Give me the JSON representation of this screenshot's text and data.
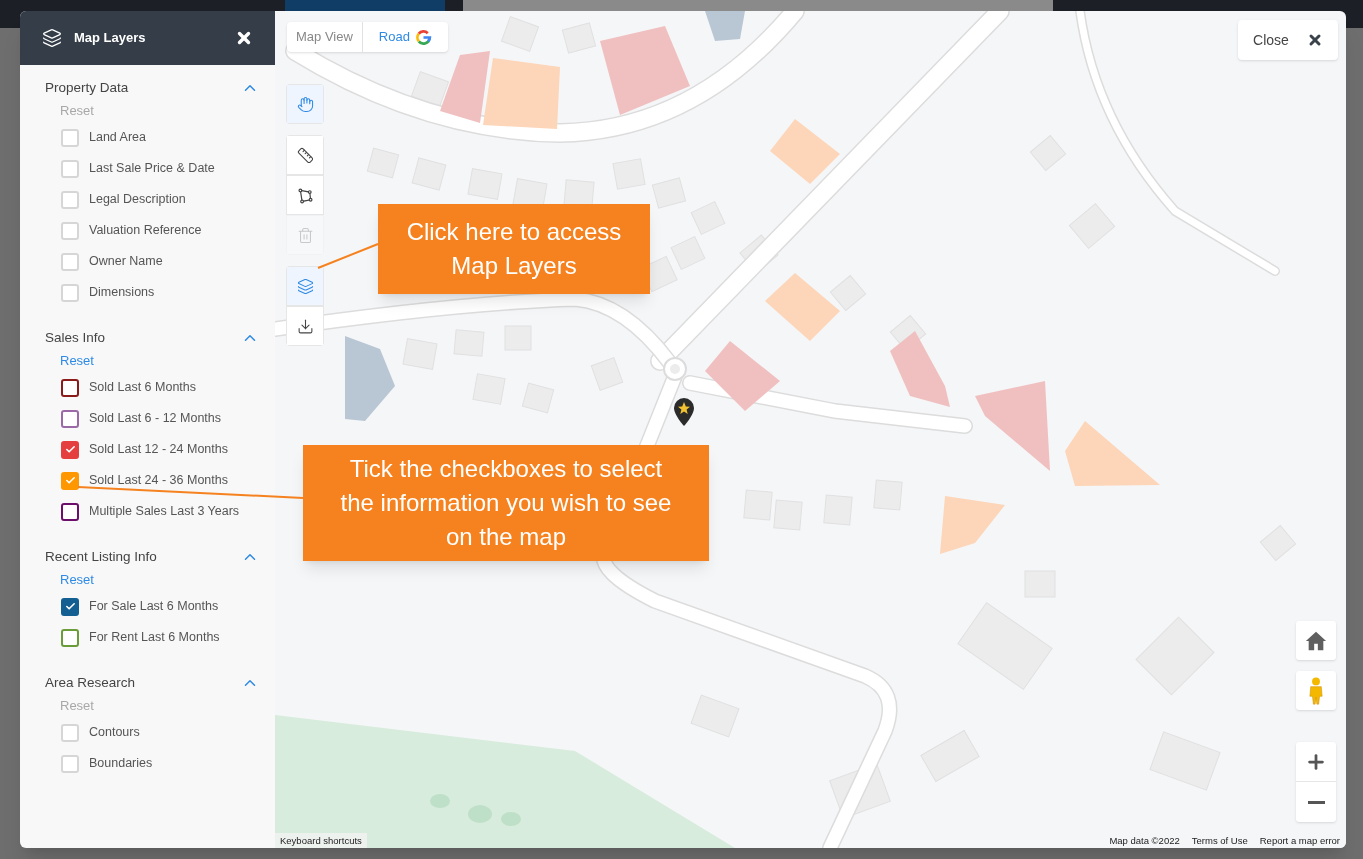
{
  "layers_panel": {
    "title": "Map Layers",
    "sections": [
      {
        "title": "Property Data",
        "expanded": true,
        "reset": {
          "label": "Reset",
          "disabled": true
        },
        "items": [
          {
            "label": "Land Area",
            "checked": false
          },
          {
            "label": "Last Sale Price & Date",
            "checked": false
          },
          {
            "label": "Legal Description",
            "checked": false
          },
          {
            "label": "Valuation Reference",
            "checked": false
          },
          {
            "label": "Owner Name",
            "checked": false
          },
          {
            "label": "Dimensions",
            "checked": false
          }
        ]
      },
      {
        "title": "Sales Info",
        "expanded": true,
        "reset": {
          "label": "Reset",
          "disabled": false
        },
        "items": [
          {
            "label": "Sold Last 6 Months",
            "checked": false,
            "color": "#8b1a1a"
          },
          {
            "label": "Sold Last 6 - 12 Months",
            "checked": false,
            "color": "#9b6aa6"
          },
          {
            "label": "Sold Last 12 - 24 Months",
            "checked": true,
            "color": "#e53e3e"
          },
          {
            "label": "Sold Last 24 - 36 Months",
            "checked": true,
            "color": "#ff9800"
          },
          {
            "label": "Multiple Sales Last 3 Years",
            "checked": false,
            "color": "#6b0f6b"
          }
        ]
      },
      {
        "title": "Recent Listing Info",
        "expanded": true,
        "reset": {
          "label": "Reset",
          "disabled": false
        },
        "items": [
          {
            "label": "For Sale Last 6 Months",
            "checked": true,
            "color": "#135f91"
          },
          {
            "label": "For Rent Last 6 Months",
            "checked": false,
            "color": "#6a9c3a"
          }
        ]
      },
      {
        "title": "Area Research",
        "expanded": true,
        "reset": {
          "label": "Reset",
          "disabled": true
        },
        "items": [
          {
            "label": "Contours",
            "checked": false
          },
          {
            "label": "Boundaries",
            "checked": false
          }
        ]
      }
    ]
  },
  "map": {
    "view_label": "Map View",
    "view_options": [
      {
        "label": "Road",
        "selected": true
      }
    ],
    "tool_groups": [
      {
        "tools": [
          {
            "kind": "hand",
            "active": true,
            "disabled": false
          }
        ]
      },
      {
        "tools": [
          {
            "kind": "ruler",
            "active": false,
            "disabled": false
          },
          {
            "kind": "polygon",
            "active": false,
            "disabled": false
          },
          {
            "kind": "trash",
            "active": false,
            "disabled": true
          }
        ]
      },
      {
        "tools": [
          {
            "kind": "layers",
            "active": true,
            "disabled": false
          },
          {
            "kind": "download",
            "active": false,
            "disabled": false
          }
        ]
      }
    ],
    "close_button": {
      "label": "Close"
    },
    "callouts": [
      {
        "text": "Click here to access Map Layers"
      },
      {
        "text": "Tick the checkboxes to select the information you wish to see on the map"
      }
    ],
    "attribution": {
      "left": "Keyboard shortcuts",
      "right": [
        "Map data ©2022",
        "Terms of Use",
        "Report a map error"
      ]
    }
  }
}
